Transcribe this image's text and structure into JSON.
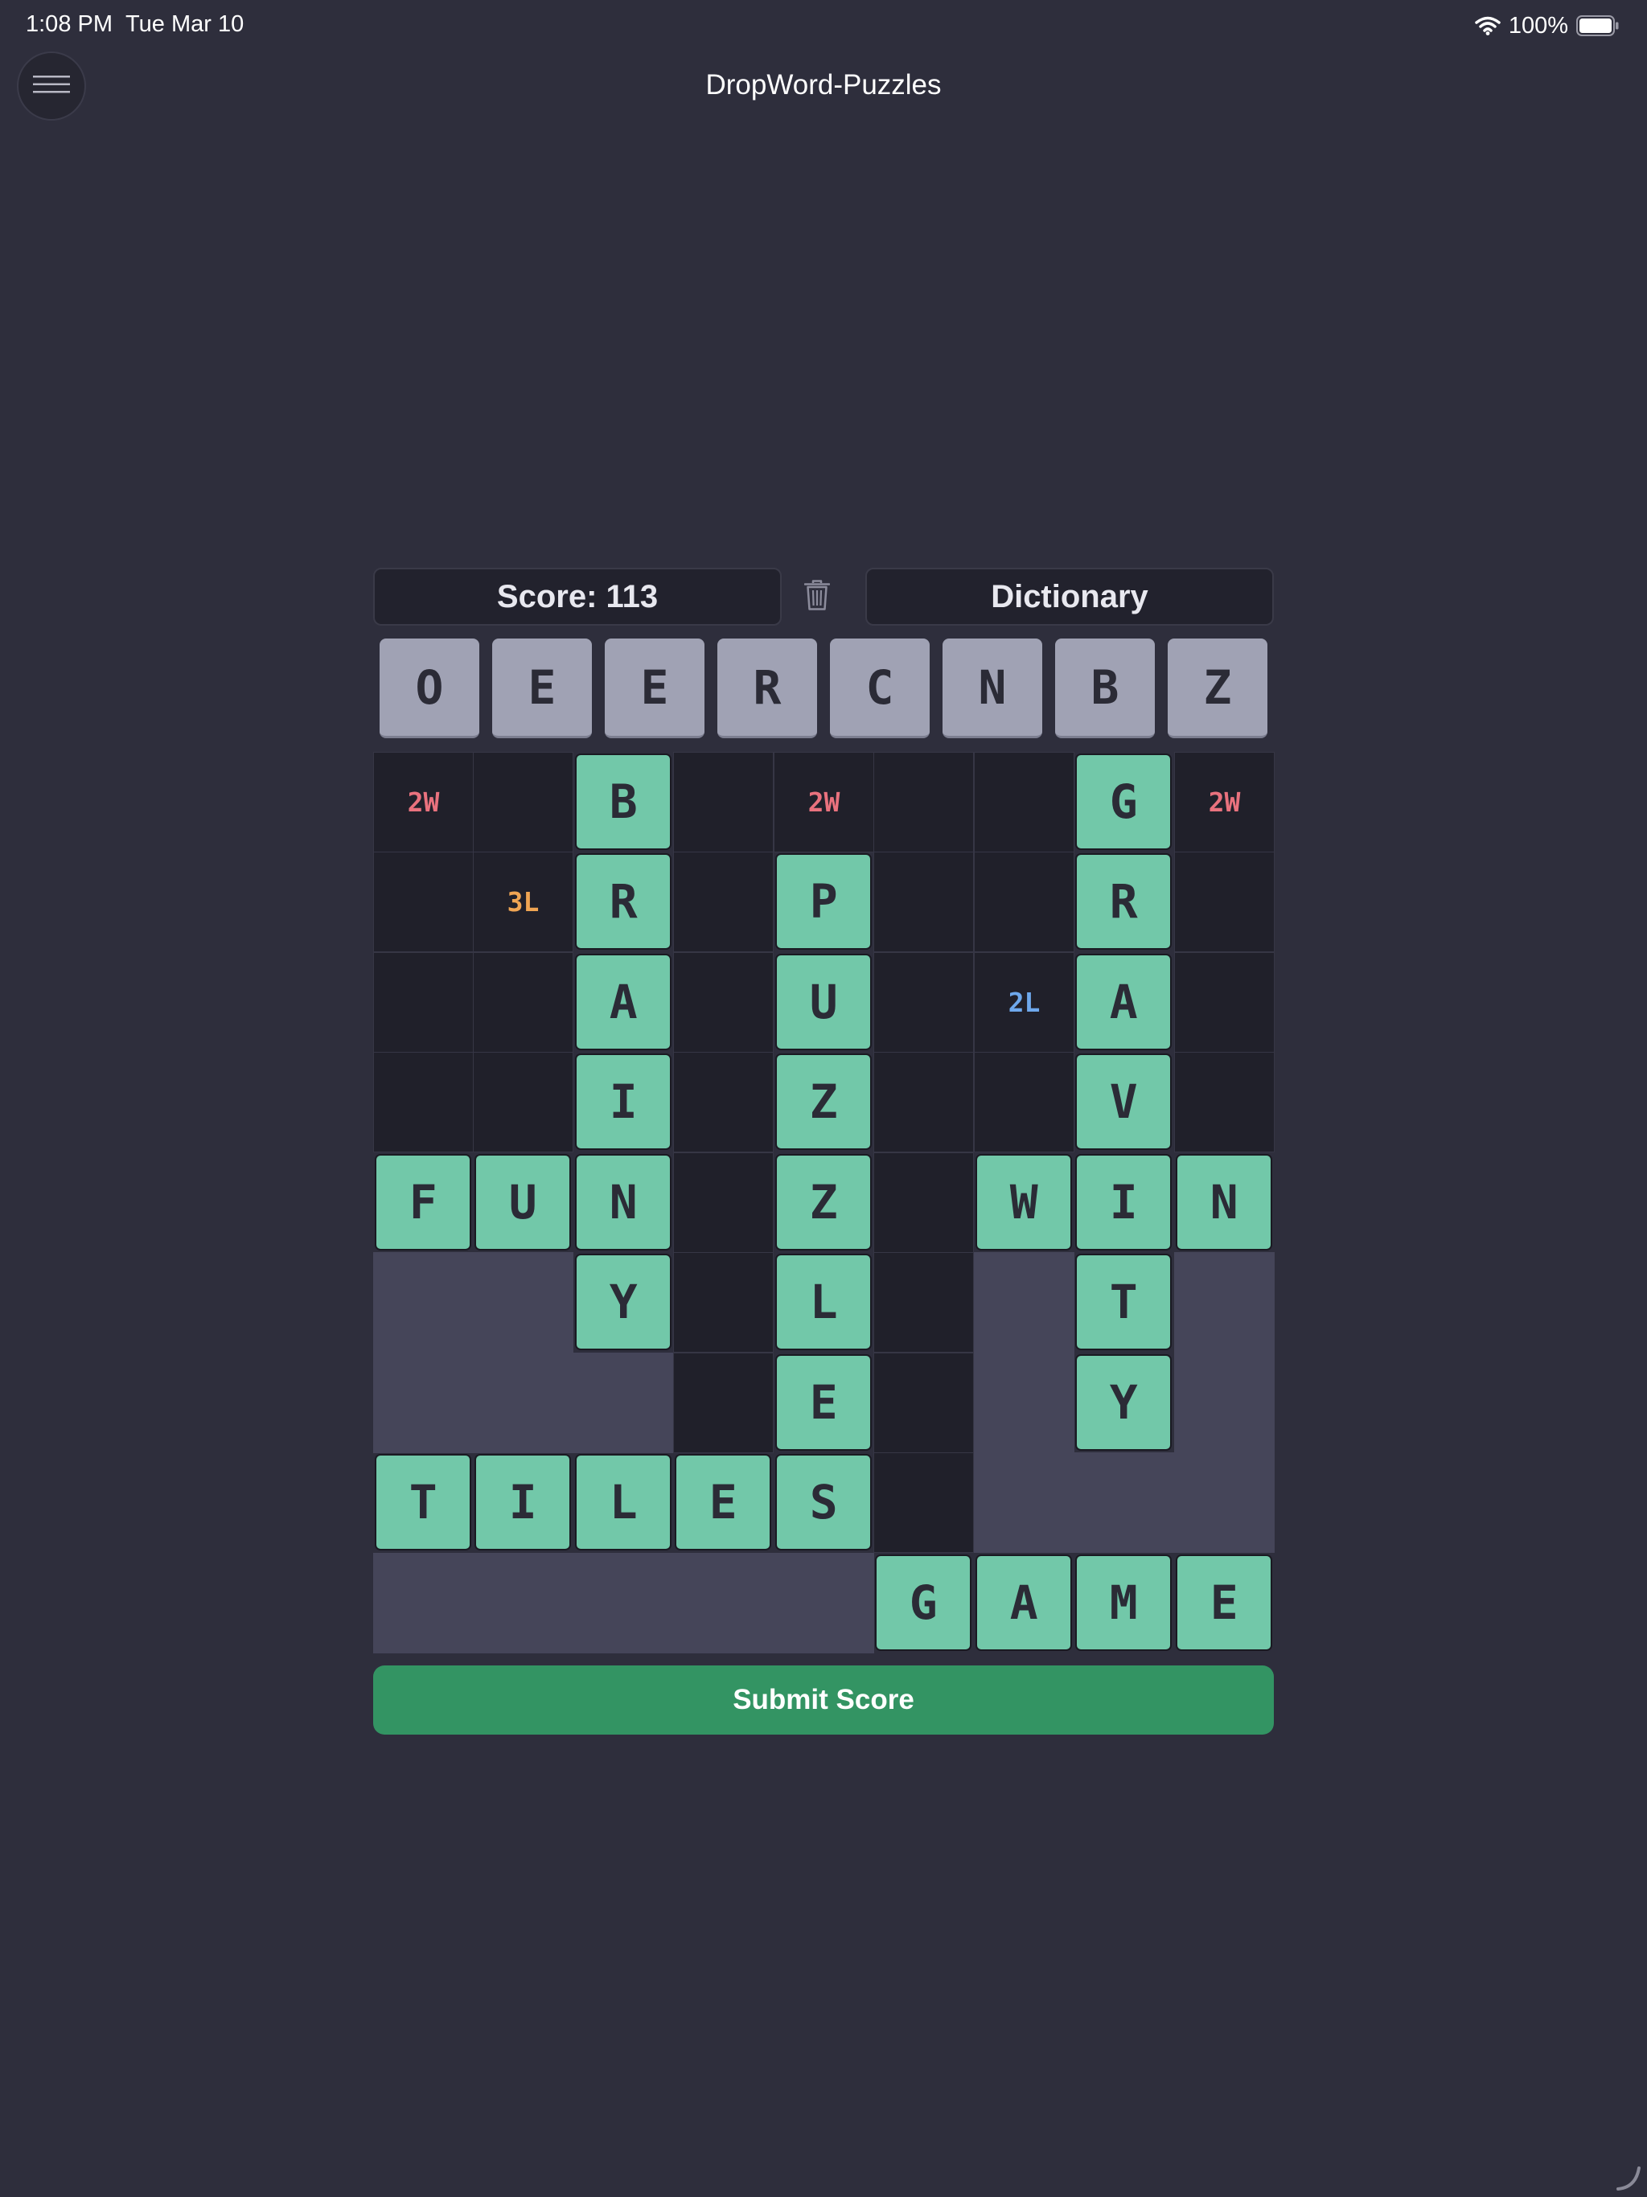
{
  "status_bar": {
    "time": "1:08 PM",
    "date": "Tue Mar 10",
    "battery": "100%"
  },
  "header": {
    "title": "DropWord-Puzzles",
    "menu_icon": "hamburger-menu-icon"
  },
  "controls": {
    "score_label": "Score: 113",
    "dictionary_label": "Dictionary",
    "trash_icon": "trash-icon"
  },
  "rack": [
    "O",
    "E",
    "E",
    "R",
    "C",
    "N",
    "B",
    "Z"
  ],
  "board": {
    "columns": 9,
    "rows": 9,
    "tiles": [
      {
        "row": 0,
        "col": 2,
        "letter": "B"
      },
      {
        "row": 1,
        "col": 2,
        "letter": "R"
      },
      {
        "row": 2,
        "col": 2,
        "letter": "A"
      },
      {
        "row": 3,
        "col": 2,
        "letter": "I"
      },
      {
        "row": 4,
        "col": 2,
        "letter": "N"
      },
      {
        "row": 5,
        "col": 2,
        "letter": "Y"
      },
      {
        "row": 0,
        "col": 7,
        "letter": "G"
      },
      {
        "row": 1,
        "col": 7,
        "letter": "R"
      },
      {
        "row": 2,
        "col": 7,
        "letter": "A"
      },
      {
        "row": 3,
        "col": 7,
        "letter": "V"
      },
      {
        "row": 4,
        "col": 7,
        "letter": "I"
      },
      {
        "row": 5,
        "col": 7,
        "letter": "T"
      },
      {
        "row": 6,
        "col": 7,
        "letter": "Y"
      },
      {
        "row": 1,
        "col": 4,
        "letter": "P"
      },
      {
        "row": 2,
        "col": 4,
        "letter": "U"
      },
      {
        "row": 3,
        "col": 4,
        "letter": "Z"
      },
      {
        "row": 4,
        "col": 4,
        "letter": "Z"
      },
      {
        "row": 5,
        "col": 4,
        "letter": "L"
      },
      {
        "row": 6,
        "col": 4,
        "letter": "E"
      },
      {
        "row": 7,
        "col": 4,
        "letter": "S"
      },
      {
        "row": 4,
        "col": 0,
        "letter": "F"
      },
      {
        "row": 4,
        "col": 1,
        "letter": "U"
      },
      {
        "row": 4,
        "col": 6,
        "letter": "W"
      },
      {
        "row": 4,
        "col": 8,
        "letter": "N"
      },
      {
        "row": 7,
        "col": 0,
        "letter": "T"
      },
      {
        "row": 7,
        "col": 1,
        "letter": "I"
      },
      {
        "row": 7,
        "col": 2,
        "letter": "L"
      },
      {
        "row": 7,
        "col": 3,
        "letter": "E"
      },
      {
        "row": 8,
        "col": 5,
        "letter": "G"
      },
      {
        "row": 8,
        "col": 6,
        "letter": "A"
      },
      {
        "row": 8,
        "col": 7,
        "letter": "M"
      },
      {
        "row": 8,
        "col": 8,
        "letter": "E"
      }
    ],
    "bonuses": [
      {
        "row": 0,
        "col": 0,
        "label": "2W",
        "color": "#e9727e"
      },
      {
        "row": 0,
        "col": 4,
        "label": "2W",
        "color": "#e9727e"
      },
      {
        "row": 0,
        "col": 8,
        "label": "2W",
        "color": "#e9727e"
      },
      {
        "row": 1,
        "col": 1,
        "label": "3L",
        "color": "#f0a553"
      },
      {
        "row": 2,
        "col": 6,
        "label": "2L",
        "color": "#6ea8ec"
      }
    ],
    "disabled": [
      {
        "row": 5,
        "col": 0
      },
      {
        "row": 5,
        "col": 1
      },
      {
        "row": 5,
        "col": 6
      },
      {
        "row": 5,
        "col": 8
      },
      {
        "row": 6,
        "col": 0
      },
      {
        "row": 6,
        "col": 1
      },
      {
        "row": 6,
        "col": 2
      },
      {
        "row": 6,
        "col": 6
      },
      {
        "row": 6,
        "col": 8
      },
      {
        "row": 7,
        "col": 6
      },
      {
        "row": 7,
        "col": 7
      },
      {
        "row": 7,
        "col": 8
      },
      {
        "row": 8,
        "col": 0
      },
      {
        "row": 8,
        "col": 1
      },
      {
        "row": 8,
        "col": 2
      },
      {
        "row": 8,
        "col": 3
      },
      {
        "row": 8,
        "col": 4
      }
    ]
  },
  "submit": {
    "label": "Submit Score"
  },
  "colors": {
    "background": "#2e2e3c",
    "tile": "#72c8a9",
    "rack_tile": "#a0a2b4",
    "submit": "#339463",
    "empty_cell": "#20202a",
    "disabled_cell": "#454559"
  }
}
